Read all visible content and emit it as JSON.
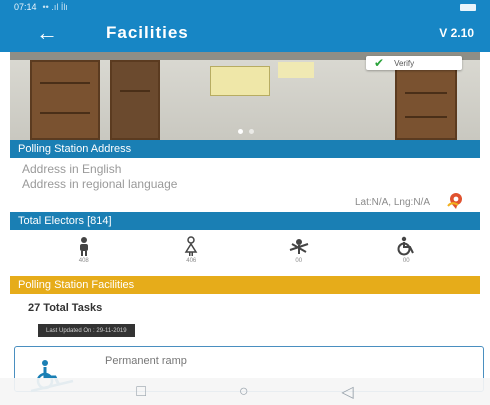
{
  "status_bar": {
    "time": "07:14",
    "signal": "•• .ıl İlı"
  },
  "app_bar": {
    "title": "Facilities",
    "version": "V 2.10",
    "back_icon": "arrow-left-icon"
  },
  "photo": {
    "verify_label": "Verify"
  },
  "address_section": {
    "header": "Polling Station Address",
    "address_english": "Address in English",
    "address_regional": "Address in regional language",
    "lat_lng": "Lat:N/A, Lng:N/A"
  },
  "electors_section": {
    "header": "Total Electors [814]",
    "items": [
      {
        "icon": "male-voter-icon",
        "count": "408"
      },
      {
        "icon": "female-voter-icon",
        "count": "406"
      },
      {
        "icon": "third-gender-icon",
        "count": "00"
      },
      {
        "icon": "disabled-voter-icon",
        "count": "00"
      }
    ]
  },
  "facilities_section": {
    "header": "Polling Station Facilities",
    "total_tasks": "27 Total Tasks",
    "last_updated": "Last Updated On : 29-11-2019",
    "cards": [
      {
        "label": "Permanent ramp",
        "icon": "wheelchair-ramp-icon"
      }
    ]
  },
  "nav_bar": {
    "items": [
      "square-icon",
      "circle-icon",
      "back-triangle-icon"
    ]
  },
  "colors": {
    "primary": "#1786c5",
    "section_blue": "#1a7fb4",
    "section_yellow": "#e6ac1a"
  }
}
